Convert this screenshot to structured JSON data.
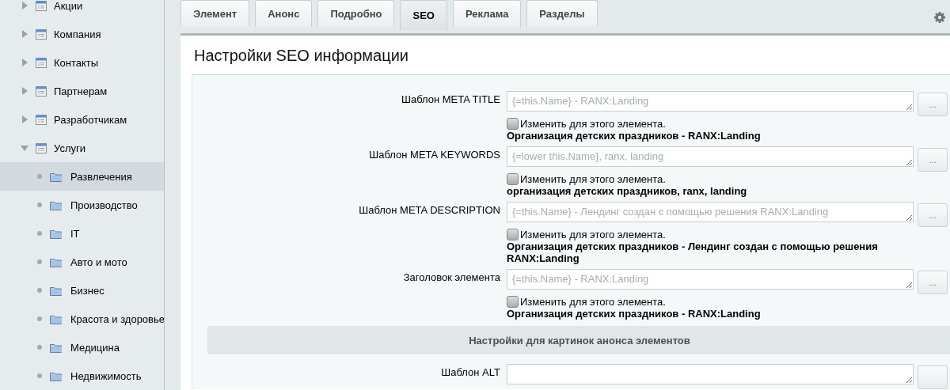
{
  "sidebar": {
    "items": [
      {
        "label": "Акции",
        "kind": "page",
        "expanded": false,
        "selected": false
      },
      {
        "label": "Компания",
        "kind": "page",
        "expanded": false,
        "selected": false
      },
      {
        "label": "Контакты",
        "kind": "page",
        "expanded": false,
        "selected": false
      },
      {
        "label": "Партнерам",
        "kind": "page",
        "expanded": false,
        "selected": false
      },
      {
        "label": "Разработчикам",
        "kind": "page",
        "expanded": false,
        "selected": false
      },
      {
        "label": "Услуги",
        "kind": "page",
        "expanded": true,
        "selected": false,
        "children": [
          {
            "label": "Развлечения",
            "kind": "folder",
            "selected": true
          },
          {
            "label": "Производство",
            "kind": "folder",
            "selected": false
          },
          {
            "label": "IT",
            "kind": "folder",
            "selected": false
          },
          {
            "label": "Авто и мото",
            "kind": "folder",
            "selected": false
          },
          {
            "label": "Бизнес",
            "kind": "folder",
            "selected": false
          },
          {
            "label": "Красота и здоровье",
            "kind": "folder",
            "selected": false
          },
          {
            "label": "Медицина",
            "kind": "folder",
            "selected": false
          },
          {
            "label": "Недвижимость",
            "kind": "folder",
            "selected": false
          }
        ]
      }
    ]
  },
  "tabs": [
    {
      "label": "Элемент",
      "selected": false
    },
    {
      "label": "Анонс",
      "selected": false
    },
    {
      "label": "Подробно",
      "selected": false
    },
    {
      "label": "SEO",
      "selected": true
    },
    {
      "label": "Реклама",
      "selected": false
    },
    {
      "label": "Разделы",
      "selected": false
    }
  ],
  "panel": {
    "title": "Настройки SEO информации",
    "rows": [
      {
        "kind": "field",
        "label": "Шаблон META TITLE",
        "placeholder": "{=this.Name} - RANX:Landing",
        "button": "...",
        "checkbox_label": "Изменить для этого элемента.",
        "checked": false,
        "preview": "Организация детских праздников - RANX:Landing"
      },
      {
        "kind": "field",
        "label": "Шаблон META KEYWORDS",
        "placeholder": "{=lower this.Name}, ranx, landing",
        "button": "...",
        "checkbox_label": "Изменить для этого элемента.",
        "checked": false,
        "preview": "организация детских праздников, ranx, landing"
      },
      {
        "kind": "field",
        "label": "Шаблон META DESCRIPTION",
        "placeholder": "{=this.Name} - Лендинг создан с помощью решения RANX:Landing",
        "button": "...",
        "checkbox_label": "Изменить для этого элемента.",
        "checked": false,
        "preview": "Организация детских праздников - Лендинг создан с помощью решения RANX:Landing"
      },
      {
        "kind": "field",
        "label": "Заголовок элемента",
        "placeholder": "{=this.Name} - RANX:Landing",
        "button": "...",
        "checkbox_label": "Изменить для этого элемента.",
        "checked": false,
        "preview": "Организация детских праздников - RANX:Landing"
      },
      {
        "kind": "section",
        "label": "Настройки для картинок анонса элементов"
      },
      {
        "kind": "field",
        "label": "Шаблон ALT"
      }
    ]
  }
}
